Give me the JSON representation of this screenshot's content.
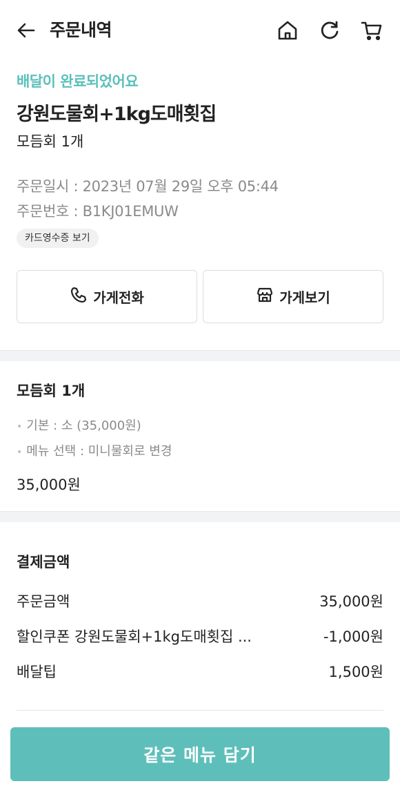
{
  "header": {
    "title": "주문내역",
    "icons": [
      "back-arrow-icon",
      "home-icon",
      "refresh-icon",
      "cart-icon"
    ]
  },
  "order": {
    "status": "배달이 완료되었어요",
    "store_name": "강원도물회+1kg도매횟집",
    "summary": "모듬회 1개",
    "order_datetime": "주문일시 : 2023년 07월 29일 오후 05:44",
    "order_number": "주문번호 : B1KJ01EMUW",
    "receipt_label": "카드영수증 보기"
  },
  "actions": {
    "call_label": "가게전화",
    "store_label": "가게보기"
  },
  "menu": {
    "name": "모듬회 1개",
    "options": [
      "기본 : 소 (35,000원)",
      "메뉴 선택 : 미니물회로 변경"
    ],
    "price": "35,000원"
  },
  "payment": {
    "title": "결제금액",
    "rows": [
      {
        "label": "주문금액",
        "value": "35,000원"
      },
      {
        "label": "할인쿠폰 강원도물회+1kg도매횟집 ...",
        "value": "-1,000원"
      },
      {
        "label": "배달팁",
        "value": "1,500원"
      }
    ]
  },
  "cta": {
    "label": "같은 메뉴 담기"
  },
  "colors": {
    "accent": "#5ebfba",
    "status_text": "#5bbfba",
    "muted_text": "#8a8a8a",
    "divider": "#f2f3f4"
  }
}
